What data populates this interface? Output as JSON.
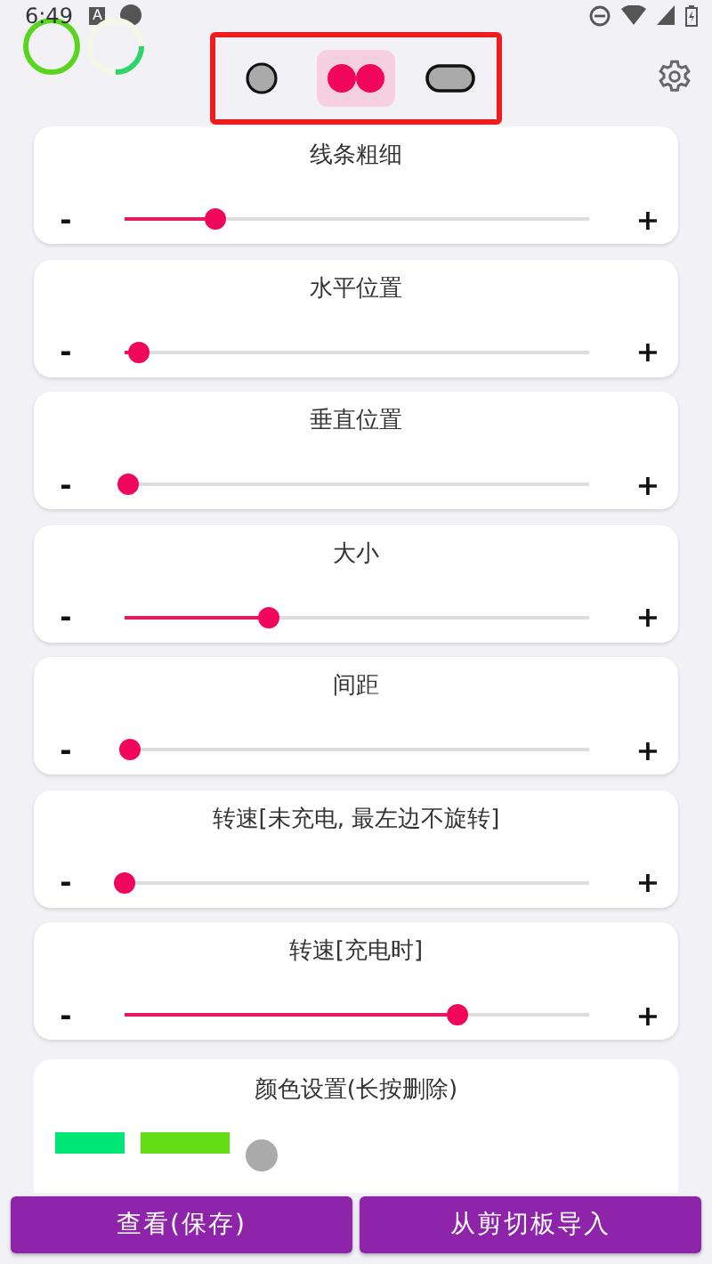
{
  "status_bar": {
    "time": "6:49",
    "notification": "A"
  },
  "shape_tabs": [
    {
      "kind": "circle",
      "selected": false
    },
    {
      "kind": "dots",
      "selected": true
    },
    {
      "kind": "pill",
      "selected": false
    }
  ],
  "sliders": [
    {
      "title": "线条粗细",
      "minus": "-",
      "plus": "+",
      "level": 0.195
    },
    {
      "title": "水平位置",
      "minus": "-",
      "plus": "+",
      "level": 0.03
    },
    {
      "title": "垂直位置",
      "minus": "-",
      "plus": "+",
      "level": 0.008
    },
    {
      "title": "大小",
      "minus": "-",
      "plus": "+",
      "level": 0.31
    },
    {
      "title": "间距",
      "minus": "-",
      "plus": "+",
      "level": 0.012
    },
    {
      "title": "转速[未充电, 最左边不旋转]",
      "minus": "-",
      "plus": "+",
      "level": 0
    },
    {
      "title": "转速[充电时]",
      "minus": "-",
      "plus": "+",
      "level": 0.717
    }
  ],
  "color_settings": {
    "title": "颜色设置(长按删除)",
    "colors": [
      {
        "color": "#00e676"
      },
      {
        "color": "#64dd17"
      }
    ]
  },
  "buttons": [
    {
      "label": "查看(保存)"
    },
    {
      "label": "从剪切板导入"
    }
  ]
}
